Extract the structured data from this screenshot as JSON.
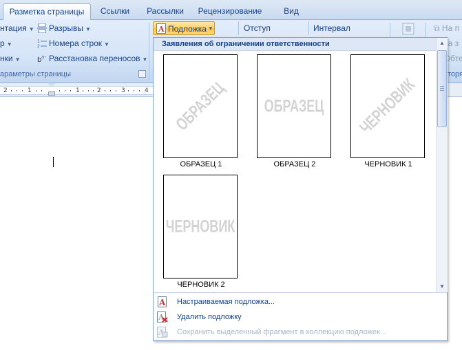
{
  "tabs": [
    {
      "label": "Разметка страницы",
      "active": true
    },
    {
      "label": "Ссылки"
    },
    {
      "label": "Рассылки"
    },
    {
      "label": "Рецензирование"
    },
    {
      "label": "Вид"
    }
  ],
  "ribbon": {
    "orientation_label": "нтация",
    "size_label": "р",
    "columns_label": "нки",
    "breaks_label": "Разрывы",
    "line_numbers_label": "Номера строк",
    "hyphenation_label": "Расстановка переносов",
    "page_setup_group_label": "араметры страницы",
    "watermark_button_label": "Подложка",
    "indent_label": "Отступ",
    "spacing_label": "Интервал",
    "right_fragments": [
      "На п",
      "На з",
      "Обте",
      "торя"
    ]
  },
  "ruler": {
    "numbers": [
      "2",
      "1",
      "1",
      "2",
      "3",
      "4"
    ]
  },
  "gallery": {
    "header": "Заявления об ограничении ответственности",
    "items": [
      {
        "watermark": "ОБРАЗЕЦ",
        "label": "ОБРАЗЕЦ 1",
        "style": "diagonal"
      },
      {
        "watermark": "ОБРАЗЕЦ",
        "label": "ОБРАЗЕЦ 2",
        "style": "horizontal"
      },
      {
        "watermark": "ЧЕРНОВИК",
        "label": "ЧЕРНОВИК 1",
        "style": "diagonal"
      },
      {
        "watermark": "ЧЕРНОВИК",
        "label": "ЧЕРНОВИК 2",
        "style": "horizontal"
      }
    ]
  },
  "menu": {
    "custom_watermark": "Настраиваемая подложка...",
    "remove_watermark": "Удалить подложку",
    "save_selection": "Сохранить выделенный фрагмент в коллекцию подложек..."
  },
  "colors": {
    "accent_text": "#15428b",
    "ribbon_bg": "#d5e4f7",
    "button_highlight": "#ffc346"
  }
}
